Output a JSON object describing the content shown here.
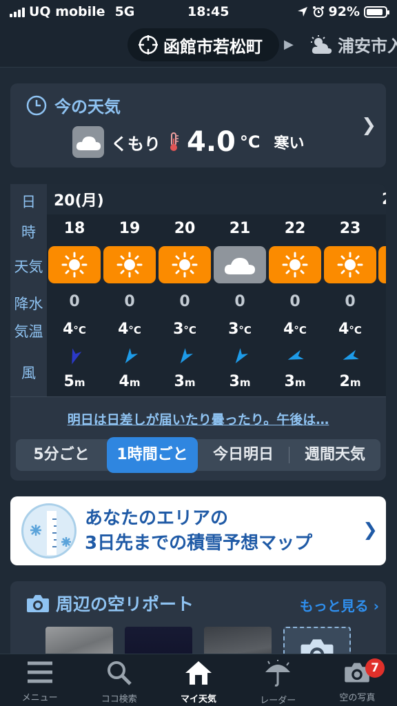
{
  "status_bar": {
    "carrier": "UQ mobile",
    "network": "5G",
    "time": "18:45",
    "battery": "92%"
  },
  "locations": {
    "current": "函館市若松町",
    "next": "浦安市入"
  },
  "now": {
    "title": "今の天気",
    "condition": "くもり",
    "temp": "4.0",
    "unit": "°C",
    "feel": "寒い"
  },
  "forecast": {
    "row_labels": {
      "day": "日",
      "hour": "時",
      "weather": "天気",
      "precip": "降水",
      "temp": "気温",
      "wind": "風"
    },
    "day": "20(月)",
    "next_day_peek": "2",
    "hours": [
      {
        "hour": "18",
        "weather": "sun",
        "precip": "0",
        "temp": "4",
        "temp_unit": "°C",
        "wind_speed": "5",
        "wind_unit": "m",
        "wind_color": "#2b39c8"
      },
      {
        "hour": "19",
        "weather": "sun",
        "precip": "0",
        "temp": "4",
        "temp_unit": "°C",
        "wind_speed": "4",
        "wind_unit": "m",
        "wind_color": "#1e9be8"
      },
      {
        "hour": "20",
        "weather": "sun",
        "precip": "0",
        "temp": "3",
        "temp_unit": "°C",
        "wind_speed": "3",
        "wind_unit": "m",
        "wind_color": "#1e9be8"
      },
      {
        "hour": "21",
        "weather": "cloud",
        "precip": "0",
        "temp": "3",
        "temp_unit": "°C",
        "wind_speed": "3",
        "wind_unit": "m",
        "wind_color": "#1e9be8"
      },
      {
        "hour": "22",
        "weather": "sun",
        "precip": "0",
        "temp": "4",
        "temp_unit": "°C",
        "wind_speed": "3",
        "wind_unit": "m",
        "wind_color": "#1e9be8"
      },
      {
        "hour": "23",
        "weather": "sun",
        "precip": "0",
        "temp": "4",
        "temp_unit": "°C",
        "wind_speed": "2",
        "wind_unit": "m",
        "wind_color": "#1e9be8"
      }
    ],
    "summary": "明日は日差しが届いたり曇ったり。午後は…",
    "segments": [
      "5分ごと",
      "1時間ごと",
      "今日明日",
      "週間天気"
    ],
    "active_segment": "1時間ごと",
    "colors": {
      "sun_tile": "#fb8b00",
      "cloud_tile": "#8f959c",
      "accent": "#2f86e0"
    }
  },
  "banner": {
    "line1": "あなたのエリアの",
    "line2": "3日先までの積雪予想マップ"
  },
  "sky_report": {
    "title": "周辺の空リポート",
    "more": "もっと見る"
  },
  "tab_bar": {
    "tabs": [
      {
        "label": "メニュー",
        "icon": "menu-icon"
      },
      {
        "label": "ココ検索",
        "icon": "search-icon"
      },
      {
        "label": "マイ天気",
        "icon": "home-icon"
      },
      {
        "label": "レーダー",
        "icon": "umbrella-icon"
      },
      {
        "label": "空の写真",
        "icon": "camera-icon"
      }
    ],
    "active": "マイ天気",
    "badge": "7"
  }
}
